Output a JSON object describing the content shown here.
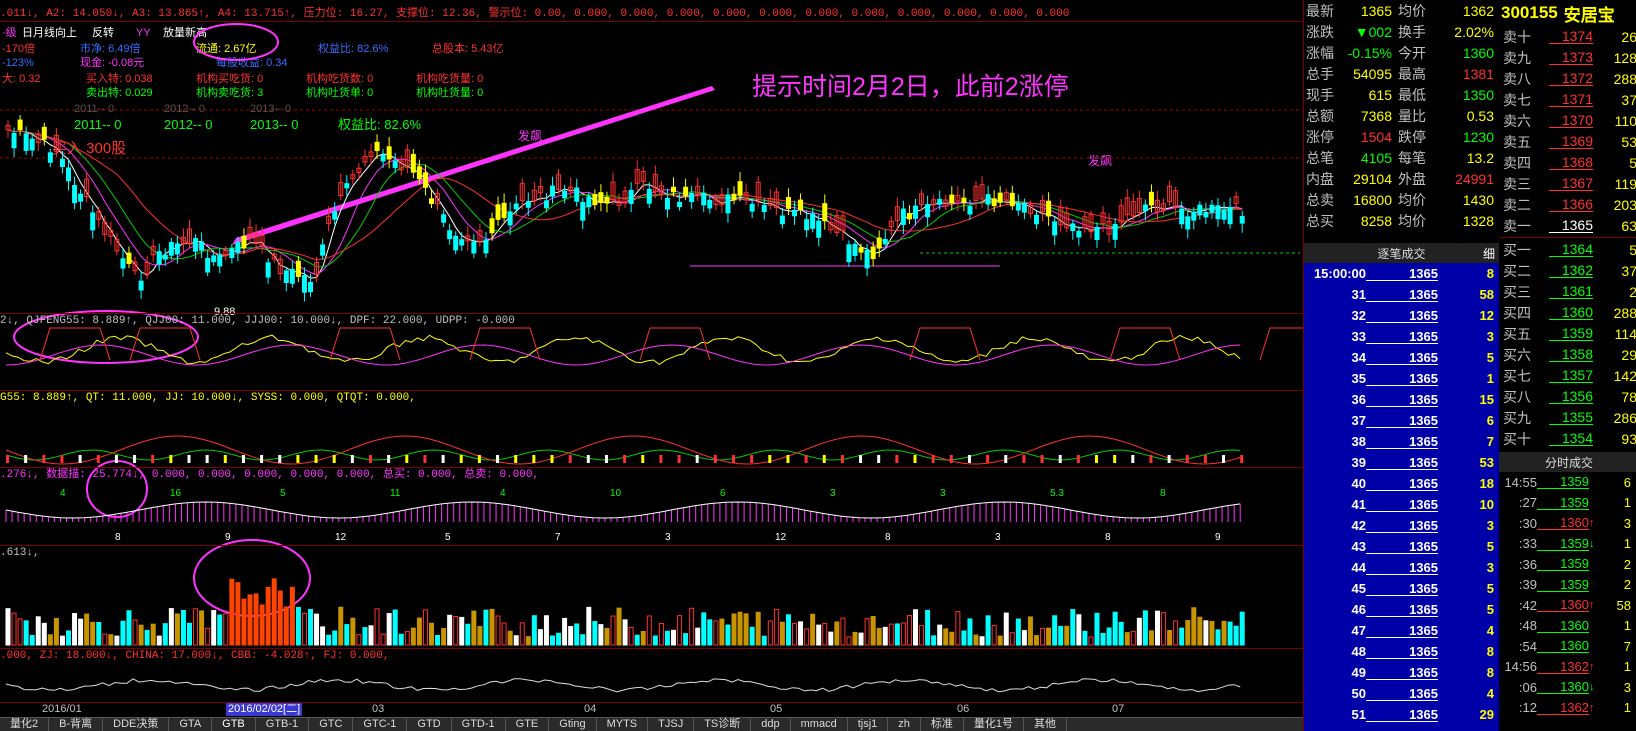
{
  "colors": {
    "up": "#ff3030",
    "down": "#00e000",
    "yellow": "#ffff00",
    "magenta": "#ff33ff",
    "cyan": "#00ffff",
    "white": "#ffffff",
    "gold": "#c89400",
    "grid": "#7a0000",
    "tickbg": "#0000a8"
  },
  "header": {
    "line1": ".011↓, A2: 14.050↓, A3: 13.865↑, A4: 13.715↑, 压力位: 16.27, 支撑位: 12.36, 警示位: 0.00, 0.000, 0.000, 0.000, 0.000, 0.000, 0.000, 0.000, 0.000, 0.000, 0.000, 0.000",
    "row2": [
      "·级",
      "日月线向上",
      "反转",
      "YY",
      "放量新高"
    ],
    "row3": [
      "-170倍",
      "市净: 6.49倍",
      "流通: 2.67亿",
      "权益比: 82.6%",
      "总股本: 5.43亿"
    ],
    "row4": [
      "-123%",
      "现金: -0.08元",
      "",
      "",
      "每股收益: 0.34"
    ],
    "row5": [
      "大: 0.32",
      "买入特: 0.038",
      "机构买吃货: 0",
      "机构吃货数: 0",
      "机构吃货量: 0"
    ],
    "row6": [
      "",
      "卖出特: 0.029",
      "机构卖吃货: 3",
      "机构吐货单: 0",
      "机构吐货量: 0"
    ],
    "row7": [
      "2011-- 0",
      "2012-- 0",
      "2013-- 0",
      "2011-- 0",
      "2012-- 0",
      "2013-- 0",
      "权益比: 82.6%"
    ],
    "buy_label": "买入 300股",
    "annotation": "提示时间2月2日，此前2涨停",
    "fa_label": "发飙",
    "low_price": "9.88"
  },
  "ind1": {
    "text": "2↓, QJFENG55: 8.889↑, QJJ00: 11.000, JJJ00: 10.000↓, DPF: 22.000, UDPP: -0.000"
  },
  "ind2": {
    "text": "G55: 8.889↑, QT: 11.000, JJ: 10.000↓, SYSS: 0.000, QTQT: 0.000,"
  },
  "ind3": {
    "text": ".276↓, 数据描: 25.774↓, 0.000, 0.000, 0.000, 0.000, 0.000, 总买: 0.000, 总卖: 0.000,",
    "nums": [
      "4",
      "8",
      "16",
      "9",
      "5",
      "12",
      "11",
      "5",
      "4",
      "7",
      "10",
      "3",
      "6",
      "12",
      "3",
      "8",
      "3",
      "3",
      "5.3",
      "8",
      "8",
      "9"
    ]
  },
  "ind4": {
    "text": ".613↓,"
  },
  "ind5": {
    "text": ".000, ZJ: 18.000↓, CHINA: 17.000↓, CBB: -4.028↑, FJ: 0.000,"
  },
  "dates": [
    "2016/01",
    "2016/02/02[二]",
    "03",
    "04",
    "05",
    "06",
    "07"
  ],
  "tabs": [
    "量化2",
    "B-背离",
    "DDE决策",
    "GTA",
    "GTB",
    "GTB-1",
    "GTC",
    "GTC-1",
    "GTD",
    "GTD-1",
    "GTE",
    "Gting",
    "MYTS",
    "TJSJ",
    "TS诊断",
    "ddp",
    "mmacd",
    "tjsj1",
    "zh",
    "标准",
    "量化1号",
    "其他"
  ],
  "quote": {
    "rows": [
      [
        "最新",
        "1365",
        "均价",
        "1362"
      ],
      [
        "涨跌",
        "▼002",
        "换手",
        "2.02%"
      ],
      [
        "涨幅",
        "-0.15%",
        "今开",
        "1360"
      ],
      [
        "总手",
        "54095",
        "最高",
        "1381"
      ],
      [
        "现手",
        "615",
        "最低",
        "1350"
      ],
      [
        "总额",
        "7368",
        "量比",
        "0.53"
      ],
      [
        "涨停",
        "1504",
        "跌停",
        "1230"
      ],
      [
        "总笔",
        "4105",
        "每笔",
        "13.2"
      ],
      [
        "内盘",
        "29104",
        "外盘",
        "24991"
      ],
      [
        "总卖",
        "16800",
        "均价",
        "1430"
      ],
      [
        "总买",
        "8258",
        "均价",
        "1328"
      ]
    ]
  },
  "orderbook": {
    "code": "300155",
    "name": "安居宝",
    "sell": [
      [
        "卖十",
        "1374",
        "26"
      ],
      [
        "卖九",
        "1373",
        "128"
      ],
      [
        "卖八",
        "1372",
        "288"
      ],
      [
        "卖七",
        "1371",
        "37"
      ],
      [
        "卖六",
        "1370",
        "110"
      ],
      [
        "卖五",
        "1369",
        "53"
      ],
      [
        "卖四",
        "1368",
        "5"
      ],
      [
        "卖三",
        "1367",
        "119"
      ],
      [
        "卖二",
        "1366",
        "203"
      ],
      [
        "卖一",
        "1365",
        "63"
      ]
    ],
    "buy": [
      [
        "买一",
        "1364",
        "5"
      ],
      [
        "买二",
        "1362",
        "37"
      ],
      [
        "买三",
        "1361",
        "2"
      ],
      [
        "买四",
        "1360",
        "288"
      ],
      [
        "买五",
        "1359",
        "114"
      ],
      [
        "买六",
        "1358",
        "29"
      ],
      [
        "买七",
        "1357",
        "142"
      ],
      [
        "买八",
        "1356",
        "78"
      ],
      [
        "买九",
        "1355",
        "286"
      ],
      [
        "买十",
        "1354",
        "93"
      ]
    ]
  },
  "ticks": {
    "title": "逐笔成交",
    "detail": "细",
    "rows": [
      [
        "15:00:00",
        "1365",
        "8"
      ],
      [
        "31",
        "1365",
        "58"
      ],
      [
        "32",
        "1365",
        "12"
      ],
      [
        "33",
        "1365",
        "3"
      ],
      [
        "34",
        "1365",
        "5"
      ],
      [
        "35",
        "1365",
        "1"
      ],
      [
        "36",
        "1365",
        "15"
      ],
      [
        "37",
        "1365",
        "6"
      ],
      [
        "38",
        "1365",
        "7"
      ],
      [
        "39",
        "1365",
        "53"
      ],
      [
        "40",
        "1365",
        "18"
      ],
      [
        "41",
        "1365",
        "10"
      ],
      [
        "42",
        "1365",
        "3"
      ],
      [
        "43",
        "1365",
        "5"
      ],
      [
        "44",
        "1365",
        "3"
      ],
      [
        "45",
        "1365",
        "5"
      ],
      [
        "46",
        "1365",
        "5"
      ],
      [
        "47",
        "1365",
        "4"
      ],
      [
        "48",
        "1365",
        "8"
      ],
      [
        "49",
        "1365",
        "8"
      ],
      [
        "50",
        "1365",
        "4"
      ],
      [
        "51",
        "1365",
        "29"
      ]
    ]
  },
  "min_ticks": {
    "title": "分时成交",
    "rows": [
      [
        "14:55",
        "1359",
        "",
        "6"
      ],
      [
        ":27",
        "1359",
        "",
        "1"
      ],
      [
        ":30",
        "1360",
        "up",
        "3"
      ],
      [
        ":33",
        "1359",
        "down",
        "1"
      ],
      [
        ":36",
        "1359",
        "",
        "2"
      ],
      [
        ":39",
        "1359",
        "",
        "2"
      ],
      [
        ":42",
        "1360",
        "up",
        "58"
      ],
      [
        ":48",
        "1360",
        "",
        "1"
      ],
      [
        ":54",
        "1360",
        "",
        "7"
      ],
      [
        "14:56",
        "1362",
        "up",
        "1"
      ],
      [
        ":06",
        "1360",
        "down",
        "3"
      ],
      [
        ":12",
        "1362",
        "up",
        "1"
      ]
    ]
  }
}
